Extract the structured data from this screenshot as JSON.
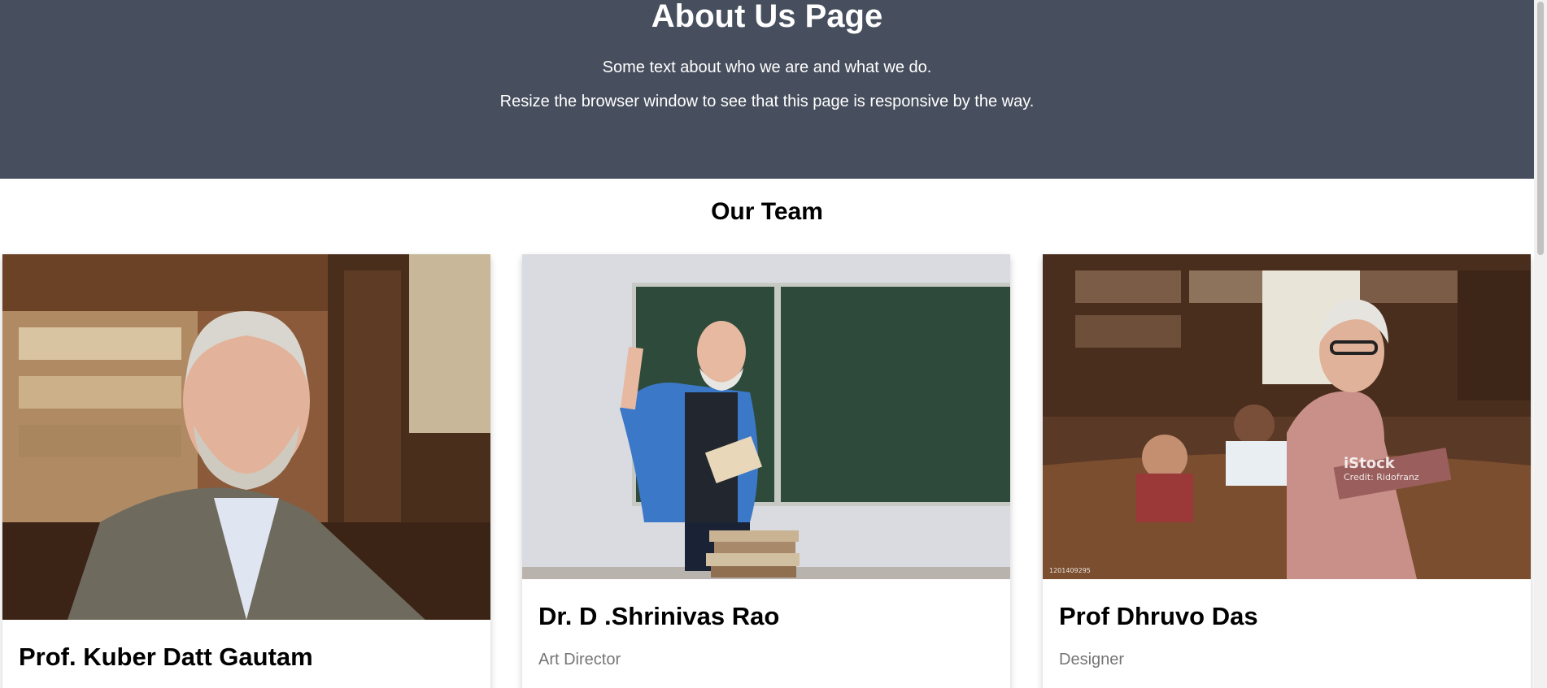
{
  "hero": {
    "title": "About Us Page",
    "line1": "Some text about who we are and what we do.",
    "line2": "Resize the browser window to see that this page is responsive by the way."
  },
  "team": {
    "heading": "Our Team",
    "members": [
      {
        "name": "Prof. Kuber Datt Gautam",
        "role": "",
        "photo": "portrait-photo"
      },
      {
        "name": "Dr. D .Shrinivas Rao",
        "role": "Art Director",
        "photo": "teacher-photo"
      },
      {
        "name": "Prof Dhruvo Das",
        "role": "Designer",
        "photo": "library-photo"
      }
    ]
  },
  "watermark": {
    "brand": "iStock",
    "credit": "Credit: Ridofranz",
    "id": "1201409295"
  },
  "colors": {
    "hero_bg": "#474e5d",
    "role_text": "#757575",
    "card_bg": "#ffffff"
  }
}
